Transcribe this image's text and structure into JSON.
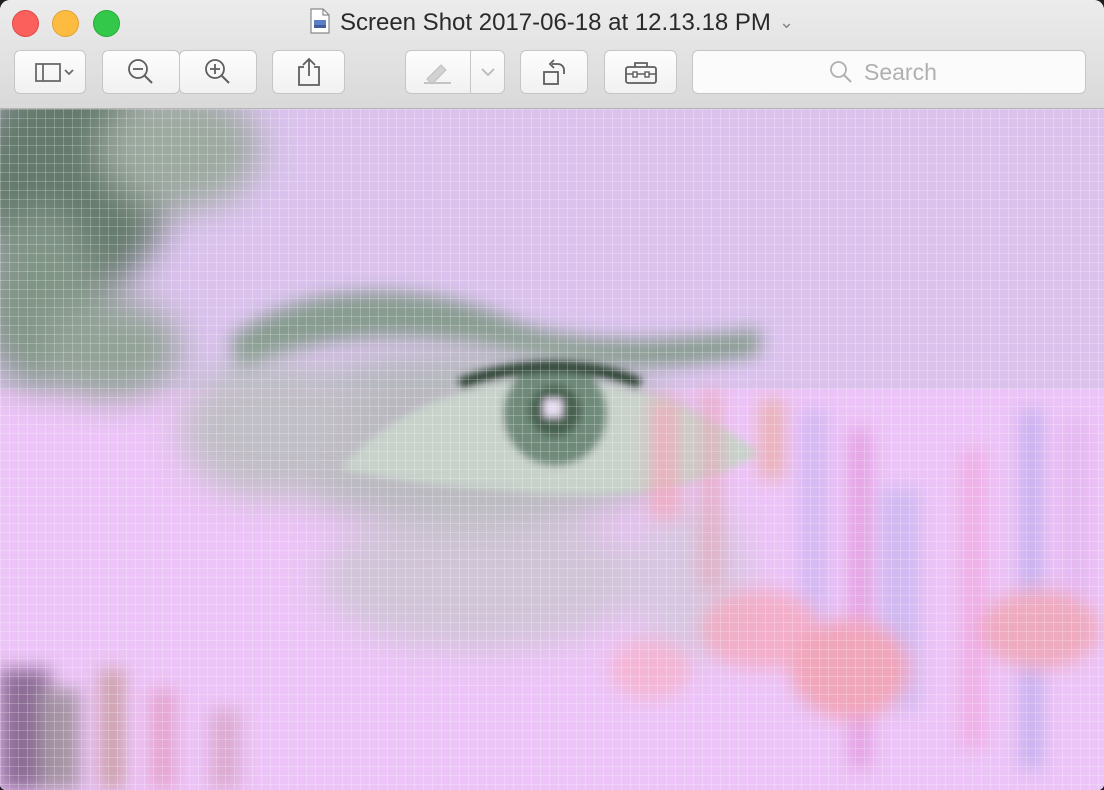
{
  "window": {
    "title": "Screen Shot 2017-06-18 at 12.13.18 PM",
    "title_icon": "document-image-icon",
    "title_chevron": "chevron-down-icon"
  },
  "toolbar": {
    "sidebar_button": "sidebar-toggle-icon",
    "zoom_out": "zoom-out-icon",
    "zoom_in": "zoom-in-icon",
    "share": "share-icon",
    "markup": "markup-pen-icon",
    "rotate": "rotate-left-icon",
    "toolbox": "toolbox-icon"
  },
  "search": {
    "placeholder": "Search"
  },
  "colors": {
    "close": "#fc605c",
    "minimize": "#fdbc40",
    "zoom": "#34c84a",
    "canvas_tint": "#e6c9f5"
  }
}
